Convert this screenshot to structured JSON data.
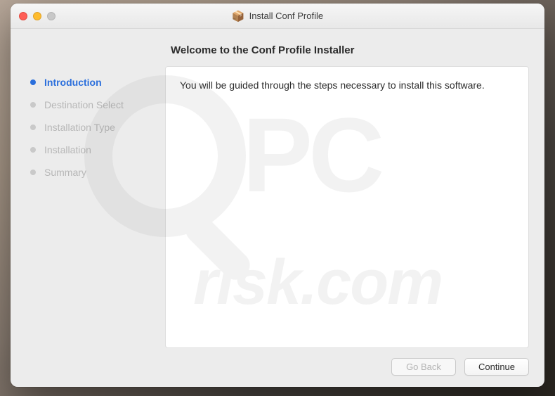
{
  "window": {
    "title": "Install Conf Profile"
  },
  "sidebar": {
    "steps": [
      {
        "label": "Introduction",
        "active": true
      },
      {
        "label": "Destination Select",
        "active": false
      },
      {
        "label": "Installation Type",
        "active": false
      },
      {
        "label": "Installation",
        "active": false
      },
      {
        "label": "Summary",
        "active": false
      }
    ]
  },
  "main": {
    "heading": "Welcome to the Conf Profile Installer",
    "body_text": "You will be guided through the steps necessary to install this software."
  },
  "buttons": {
    "back": "Go Back",
    "continue": "Continue"
  },
  "icons": {
    "package": "📦"
  }
}
